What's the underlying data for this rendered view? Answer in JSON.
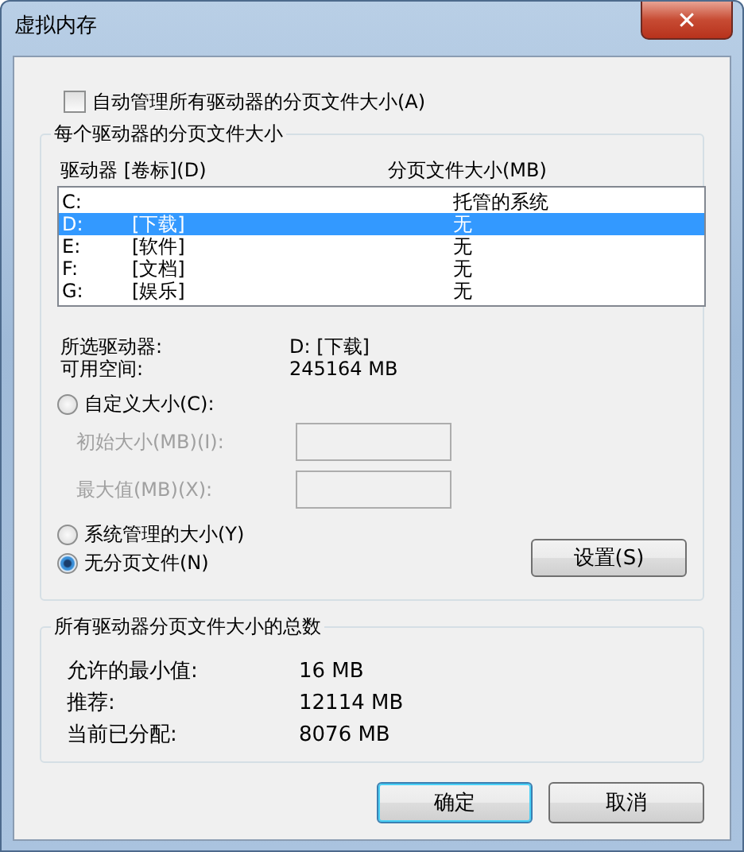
{
  "window": {
    "title": "虚拟内存",
    "close": "✕"
  },
  "auto_manage": {
    "label": "自动管理所有驱动器的分页文件大小(A)",
    "checked": false
  },
  "drives_group": {
    "title": "每个驱动器的分页文件大小",
    "columns": [
      "驱动器 [卷标](D)",
      "分页文件大小(MB)"
    ],
    "rows": [
      {
        "drive": "C:",
        "label": "",
        "size": "托管的系统",
        "selected": false
      },
      {
        "drive": "D:",
        "label": "[下载]",
        "size": "无",
        "selected": true
      },
      {
        "drive": "E:",
        "label": "[软件]",
        "size": "无",
        "selected": false
      },
      {
        "drive": "F:",
        "label": "[文档]",
        "size": "无",
        "selected": false
      },
      {
        "drive": "G:",
        "label": "[娱乐]",
        "size": "无",
        "selected": false
      }
    ],
    "info": [
      {
        "label": "所选驱动器:",
        "value": "D:  [下载]"
      },
      {
        "label": "可用空间:",
        "value": "245164 MB"
      }
    ],
    "custom_option": {
      "label": "自定义大小(C):",
      "selected": false
    },
    "fields": [
      {
        "label": "初始大小(MB)(I):",
        "disabled": true
      },
      {
        "label": "最大值(MB)(X):",
        "disabled": true
      }
    ],
    "options": [
      {
        "label": "系统管理的大小(Y)",
        "selected": false
      },
      {
        "label": "无分页文件(N)",
        "selected": true
      }
    ],
    "set_button": "设置(S)"
  },
  "totals_group": {
    "title": "所有驱动器分页文件大小的总数",
    "items": [
      {
        "label": "允许的最小值:",
        "value": "16 MB"
      },
      {
        "label": "推荐:",
        "value": "12114 MB"
      },
      {
        "label": "当前已分配:",
        "value": "8076 MB"
      }
    ]
  },
  "buttons": [
    {
      "label": "确定",
      "kind": "default"
    },
    {
      "label": "取消",
      "kind": "normal"
    }
  ]
}
